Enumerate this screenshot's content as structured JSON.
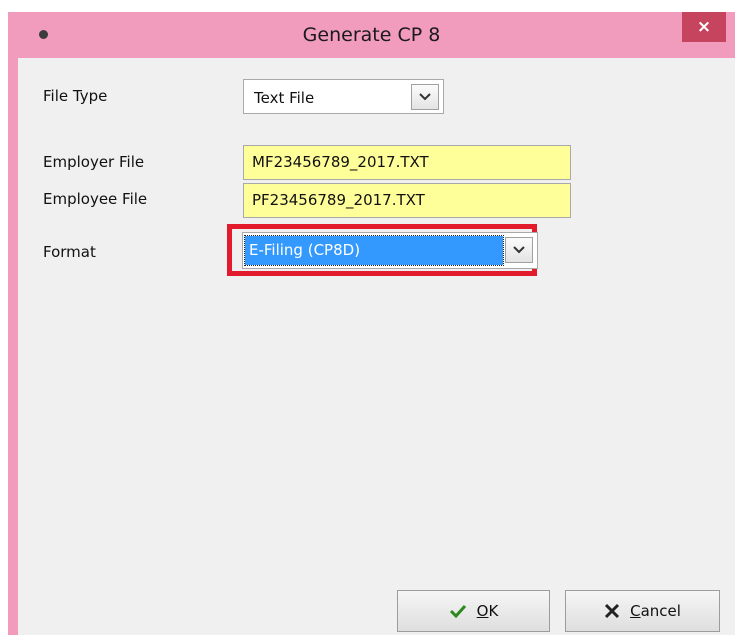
{
  "window": {
    "title": "Generate CP 8",
    "close_glyph": "×"
  },
  "form": {
    "file_type": {
      "label": "File Type",
      "value": "Text File"
    },
    "employer_file": {
      "label": "Employer File",
      "value": "MF23456789_2017.TXT"
    },
    "employee_file": {
      "label": "Employee File",
      "value": "PF23456789_2017.TXT"
    },
    "format": {
      "label": "Format",
      "value": "E-Filing (CP8D)"
    }
  },
  "buttons": {
    "ok": {
      "mnemonic": "O",
      "rest": "K",
      "icon": "check-icon"
    },
    "cancel": {
      "mnemonic": "C",
      "rest": "ancel",
      "icon": "x-icon"
    }
  },
  "colors": {
    "titlebar": "#f19bbd",
    "close_button": "#c7445f",
    "highlight_border": "#e11b2c",
    "input_bg": "#ffff99",
    "selection": "#3399ff"
  }
}
